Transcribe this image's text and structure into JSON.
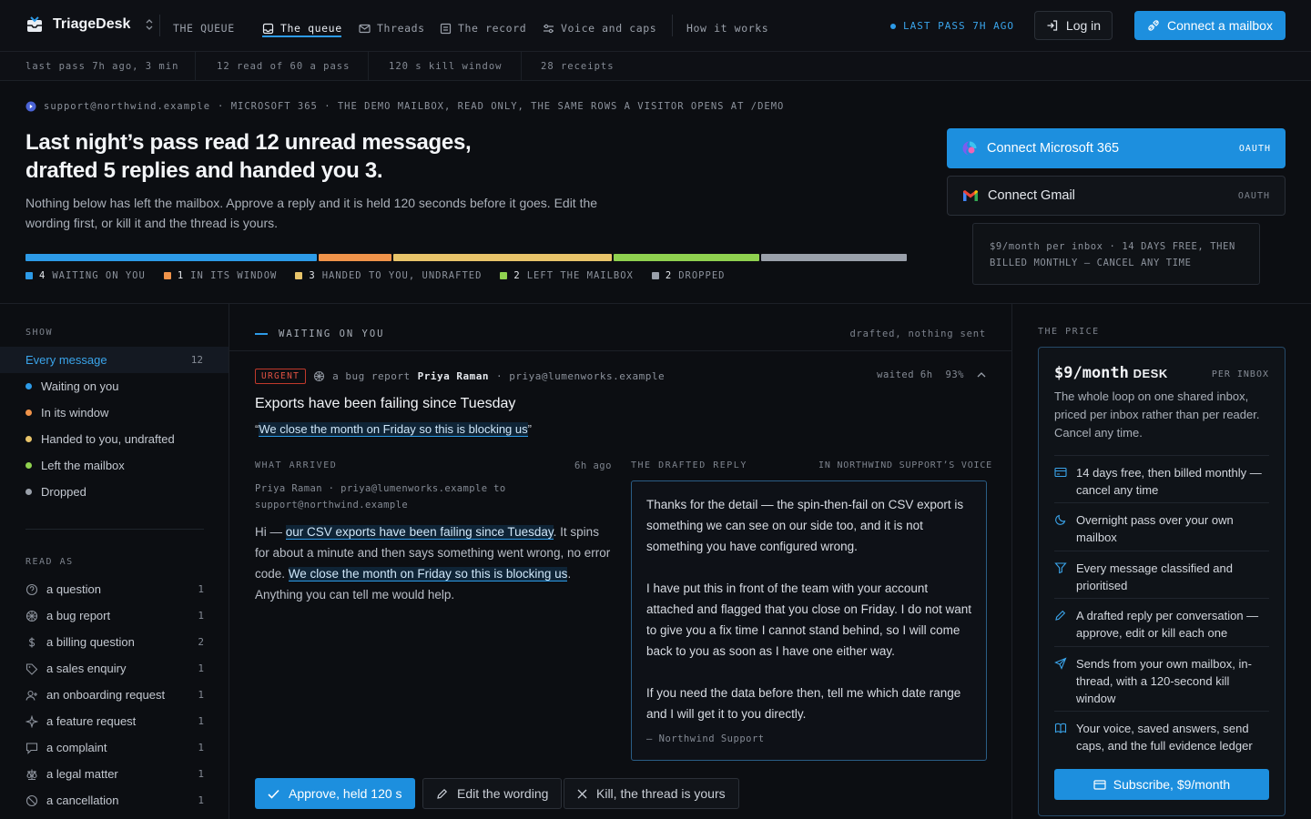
{
  "app": {
    "name": "TriageDesk"
  },
  "nav": {
    "section": "THE QUEUE",
    "items": [
      {
        "label": "The queue",
        "icon": "inbox-icon"
      },
      {
        "label": "Threads",
        "icon": "mail-icon"
      },
      {
        "label": "The record",
        "icon": "ledger-icon"
      },
      {
        "label": "Voice and caps",
        "icon": "sliders-icon"
      }
    ],
    "how": "How it works",
    "last_pass": "LAST PASS 7H AGO",
    "login": "Log in",
    "connect": "Connect a mailbox"
  },
  "stats": [
    "last pass 7h ago, 3 min",
    "12 read of 60 a pass",
    "120 s kill window",
    "28 receipts"
  ],
  "hero": {
    "mailbox": "support@northwind.example",
    "source": "· MICROSOFT 365 · THE DEMO MAILBOX, READ ONLY, THE SAME ROWS A VISITOR OPENS AT /DEMO",
    "title_line1": "Last night’s pass read 12 unread messages,",
    "title_line2": "drafted 5 replies and handed you 3.",
    "desc": "Nothing below has left the mailbox. Approve a reply and it is held 120 seconds before it goes. Edit the wording first, or kill it and the thread is yours.",
    "breakdown": [
      {
        "count": "4",
        "label": "WAITING ON YOU",
        "value": 4,
        "color": "#2d9be8"
      },
      {
        "count": "1",
        "label": "IN ITS WINDOW",
        "value": 1,
        "color": "#f0934a"
      },
      {
        "count": "3",
        "label": "HANDED TO YOU, UNDRAFTED",
        "value": 3,
        "color": "#e8c46a"
      },
      {
        "count": "2",
        "label": "LEFT THE MAILBOX",
        "value": 2,
        "color": "#8fd14f"
      },
      {
        "count": "2",
        "label": "DROPPED",
        "value": 2,
        "color": "#9aa0aa"
      }
    ],
    "connect_ms": "Connect Microsoft 365",
    "connect_gmail": "Connect Gmail",
    "oauth": "OAUTH",
    "price_note": "$9/month per inbox · 14 DAYS FREE, THEN BILLED MONTHLY — CANCEL ANY TIME"
  },
  "sidebar": {
    "show_label": "SHOW",
    "show": [
      {
        "label": "Every message",
        "count": "12",
        "color": ""
      },
      {
        "label": "Waiting on you",
        "count": "",
        "color": "#2d9be8"
      },
      {
        "label": "In its window",
        "count": "",
        "color": "#f0934a"
      },
      {
        "label": "Handed to you, undrafted",
        "count": "",
        "color": "#e8c46a"
      },
      {
        "label": "Left the mailbox",
        "count": "",
        "color": "#8fd14f"
      },
      {
        "label": "Dropped",
        "count": "",
        "color": "#9aa0aa"
      }
    ],
    "read_label": "READ AS",
    "read_as": [
      {
        "label": "a question",
        "count": "1",
        "icon": "question-icon"
      },
      {
        "label": "a bug report",
        "count": "1",
        "icon": "bug-icon"
      },
      {
        "label": "a billing question",
        "count": "2",
        "icon": "dollar-icon"
      },
      {
        "label": "a sales enquiry",
        "count": "1",
        "icon": "tag-icon"
      },
      {
        "label": "an onboarding request",
        "count": "1",
        "icon": "user-plus-icon"
      },
      {
        "label": "a feature request",
        "count": "1",
        "icon": "sparkle-icon"
      },
      {
        "label": "a complaint",
        "count": "1",
        "icon": "message-icon"
      },
      {
        "label": "a legal matter",
        "count": "1",
        "icon": "scale-icon"
      },
      {
        "label": "a cancellation",
        "count": "1",
        "icon": "ban-icon"
      }
    ]
  },
  "main": {
    "heading": "WAITING ON YOU",
    "heading_note": "drafted, nothing sent",
    "message": {
      "badge": "URGENT",
      "kind": "a bug report",
      "sender": "Priya Raman",
      "email": "· priya@lumenworks.example",
      "waited": "waited 6h",
      "confidence": "93%",
      "subject": "Exports have been failing since Tuesday",
      "quote": "We close the month on Friday so this is blocking us",
      "arrived_label": "WHAT ARRIVED",
      "arrived_time": "6h ago",
      "arrived_from": "Priya Raman · priya@lumenworks.example to support@northwind.example",
      "body_a": "Hi — ",
      "body_hl1": "our CSV exports have been failing since Tuesday",
      "body_b": ". It spins for about a minute and then says something went wrong, no error code. ",
      "body_hl2": "We close the month on Friday so this is blocking us",
      "body_c": ". Anything you can tell me would help.",
      "draft_label": "THE DRAFTED REPLY",
      "draft_voice": "IN NORTHWIND SUPPORT’S VOICE",
      "draft_p1": "Thanks for the detail — the spin-then-fail on CSV export is something we can see on our side too, and it is not something you have configured wrong.",
      "draft_p2": "I have put this in front of the team with your account attached and flagged that you close on Friday. I do not want to give you a fix time I cannot stand behind, so I will come back to you as soon as I have one either way.",
      "draft_p3": "If you need the data before then, tell me which date range and I will get it to you directly.",
      "draft_sign": "— Northwind Support"
    },
    "actions": {
      "approve": "Approve, held 120 s",
      "edit": "Edit the wording",
      "kill": "Kill, the thread is yours"
    }
  },
  "price": {
    "label": "THE PRICE",
    "amount": "$9/month",
    "unit": "DESK",
    "per": "PER INBOX",
    "desc": "The whole loop on one shared inbox, priced per inbox rather than per reader. Cancel any time.",
    "features": [
      {
        "text": "14 days free, then billed monthly — cancel any time",
        "icon": "card-icon"
      },
      {
        "text": "Overnight pass over your own mailbox",
        "icon": "moon-icon"
      },
      {
        "text": "Every message classified and prioritised",
        "icon": "filter-icon"
      },
      {
        "text": "A drafted reply per conversation — approve, edit or kill each one",
        "icon": "pencil-icon"
      },
      {
        "text": "Sends from your own mailbox, in-thread, with a 120-second kill window",
        "icon": "send-icon"
      },
      {
        "text": "Your voice, saved answers, send caps, and the full evidence ledger",
        "icon": "book-icon"
      }
    ],
    "subscribe": "Subscribe, $9/month"
  }
}
